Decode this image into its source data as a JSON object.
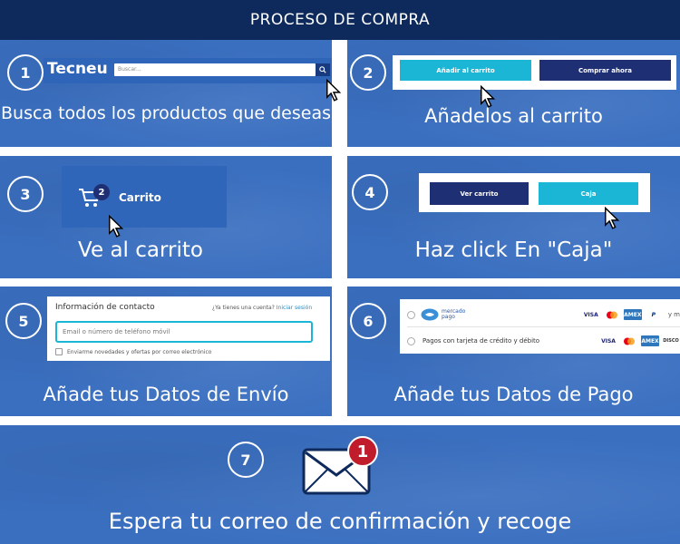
{
  "header": {
    "title": "PROCESO DE COMPRA"
  },
  "steps": [
    {
      "num": "1",
      "caption": "Busca todos los productos que deseas"
    },
    {
      "num": "2",
      "caption": "Añadelos al carrito"
    },
    {
      "num": "3",
      "caption": "Ve al carrito"
    },
    {
      "num": "4",
      "caption": "Haz click En \"Caja\""
    },
    {
      "num": "5",
      "caption": "Añade tus Datos de Envío"
    },
    {
      "num": "6",
      "caption": "Añade tus Datos de Pago"
    },
    {
      "num": "7",
      "caption": "Espera tu correo de confirmación y recoge"
    }
  ],
  "step1": {
    "logo": "Tecneu",
    "search_placeholder": "Buscar...",
    "search_icon": "search-icon"
  },
  "step2": {
    "add_to_cart": "Añadir al carrito",
    "buy_now": "Comprar ahora"
  },
  "step3": {
    "cart_count": "2",
    "cart_label": "Carrito",
    "cart_icon": "cart-icon"
  },
  "step4": {
    "view_cart": "Ver carrito",
    "checkout": "Caja"
  },
  "step5": {
    "title": "Información de contacto",
    "account_prompt": "¿Ya tienes una cuenta?",
    "login_link": "Iniciar sesión",
    "email_placeholder": "Email o número de teléfono móvil",
    "newsletter_label": "Enviarme novedades y ofertas por correo electrónico"
  },
  "step6": {
    "option1_brand": "mercado pago",
    "option1_more": "y m",
    "option2_label": "Pagos con tarjeta de crédito y débito",
    "cards1": [
      "VISA",
      "AMEX",
      "P"
    ],
    "cards2": [
      "VISA",
      "AMEX",
      "DISCO"
    ]
  },
  "step7": {
    "notification_count": "1"
  },
  "colors": {
    "header": "#0e2a5c",
    "panel": "#3a6fc0",
    "cyan": "#1bb5d6",
    "navy": "#1e2f74",
    "badge": "#c01c2c"
  }
}
